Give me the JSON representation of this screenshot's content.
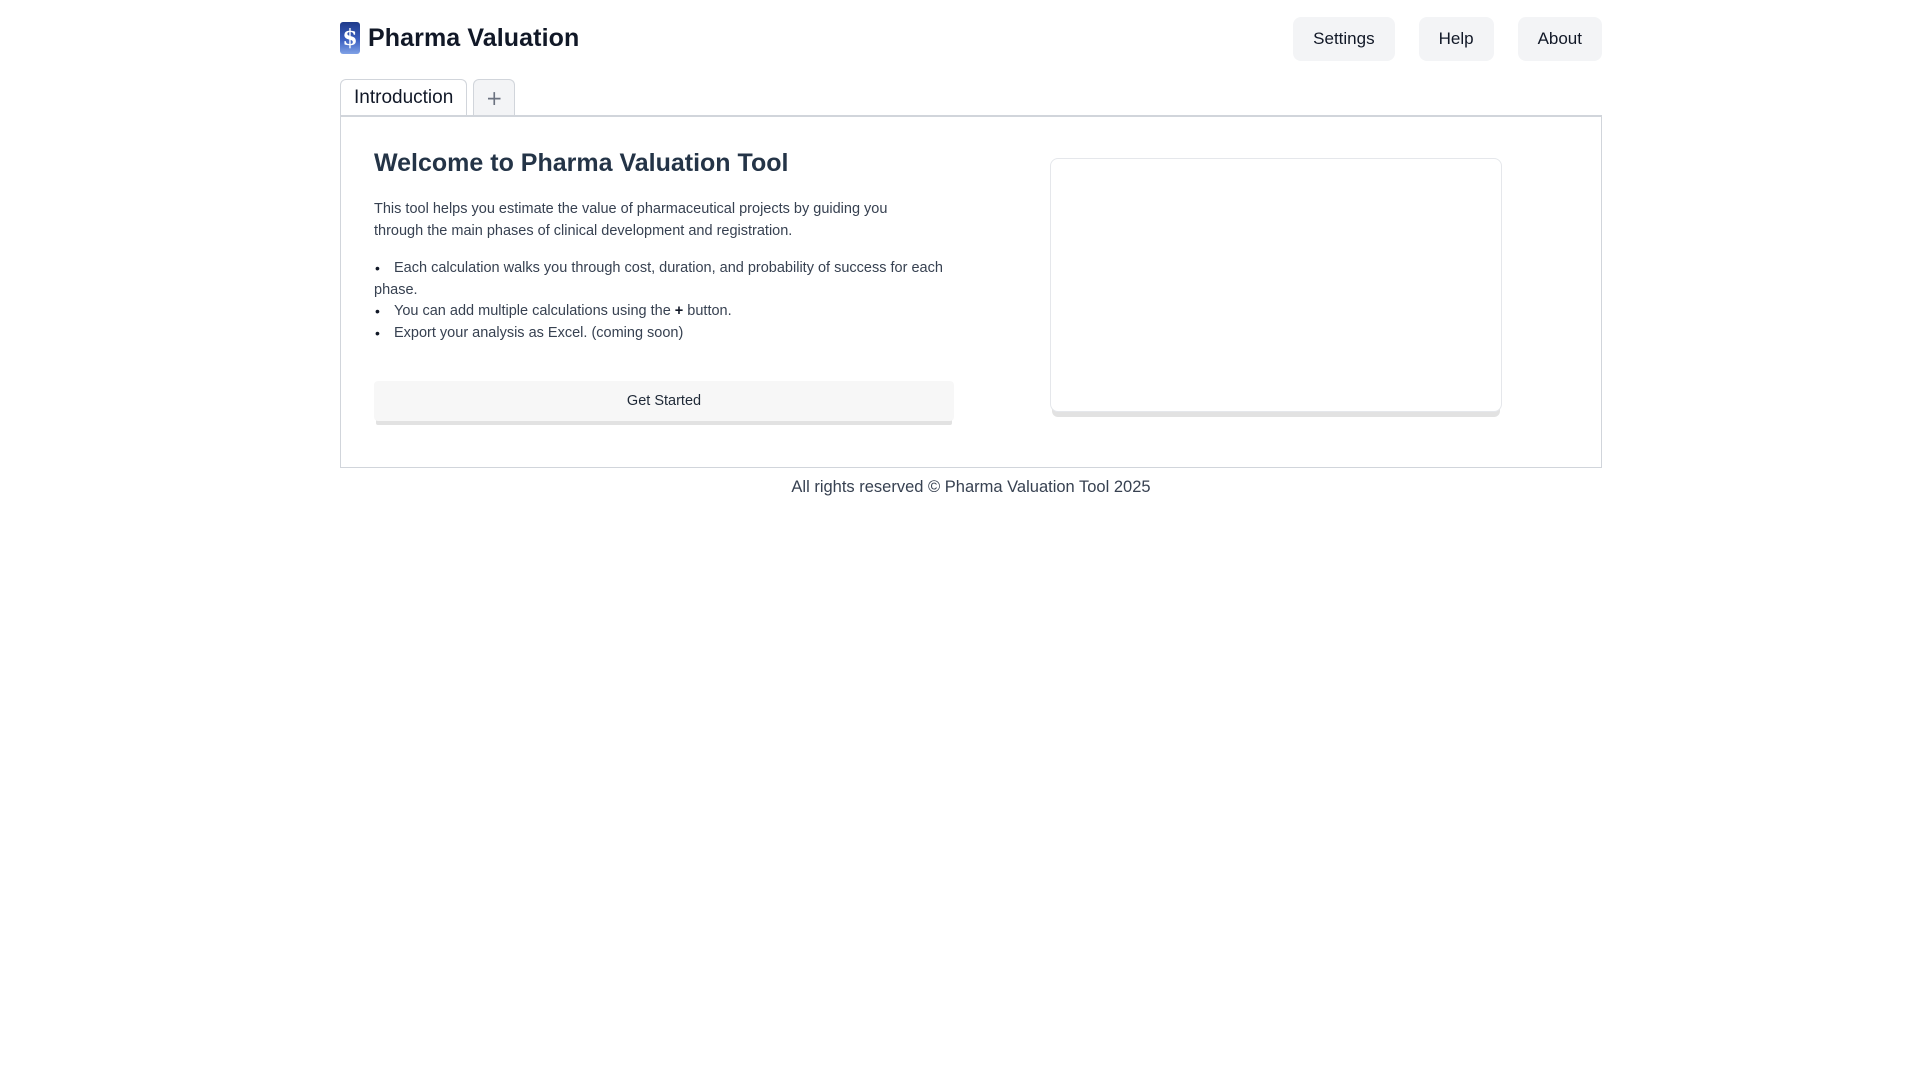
{
  "header": {
    "logo_glyph": "$",
    "title": "Pharma Valuation",
    "nav": [
      {
        "label": "Settings"
      },
      {
        "label": "Help"
      },
      {
        "label": "About"
      }
    ]
  },
  "tabs": {
    "items": [
      {
        "label": "Introduction",
        "active": true
      }
    ],
    "add_label": "+"
  },
  "intro": {
    "title": "Welcome to Pharma Valuation Tool",
    "description_line1": "This tool helps you estimate the value of pharmaceutical projects by guiding you",
    "description_line2": "through the main phases of clinical development and registration.",
    "bullets": {
      "b1": "Each calculation walks you through cost, duration, and probability of success for each phase.",
      "b2_before": "You can add multiple calculations using the ",
      "b2_strong": "+",
      "b2_after": " button.",
      "b3": "Export your analysis as Excel. (coming soon)"
    },
    "cta_label": "Get Started"
  },
  "footer": {
    "text": "All rights reserved © Pharma Valuation Tool 2025"
  },
  "colors": {
    "brand_dark": "#1e3a8a",
    "brand_light": "#7fa1e6",
    "button_bg": "#f3f4f6",
    "border": "#d1d5db",
    "heading": "#243447"
  }
}
